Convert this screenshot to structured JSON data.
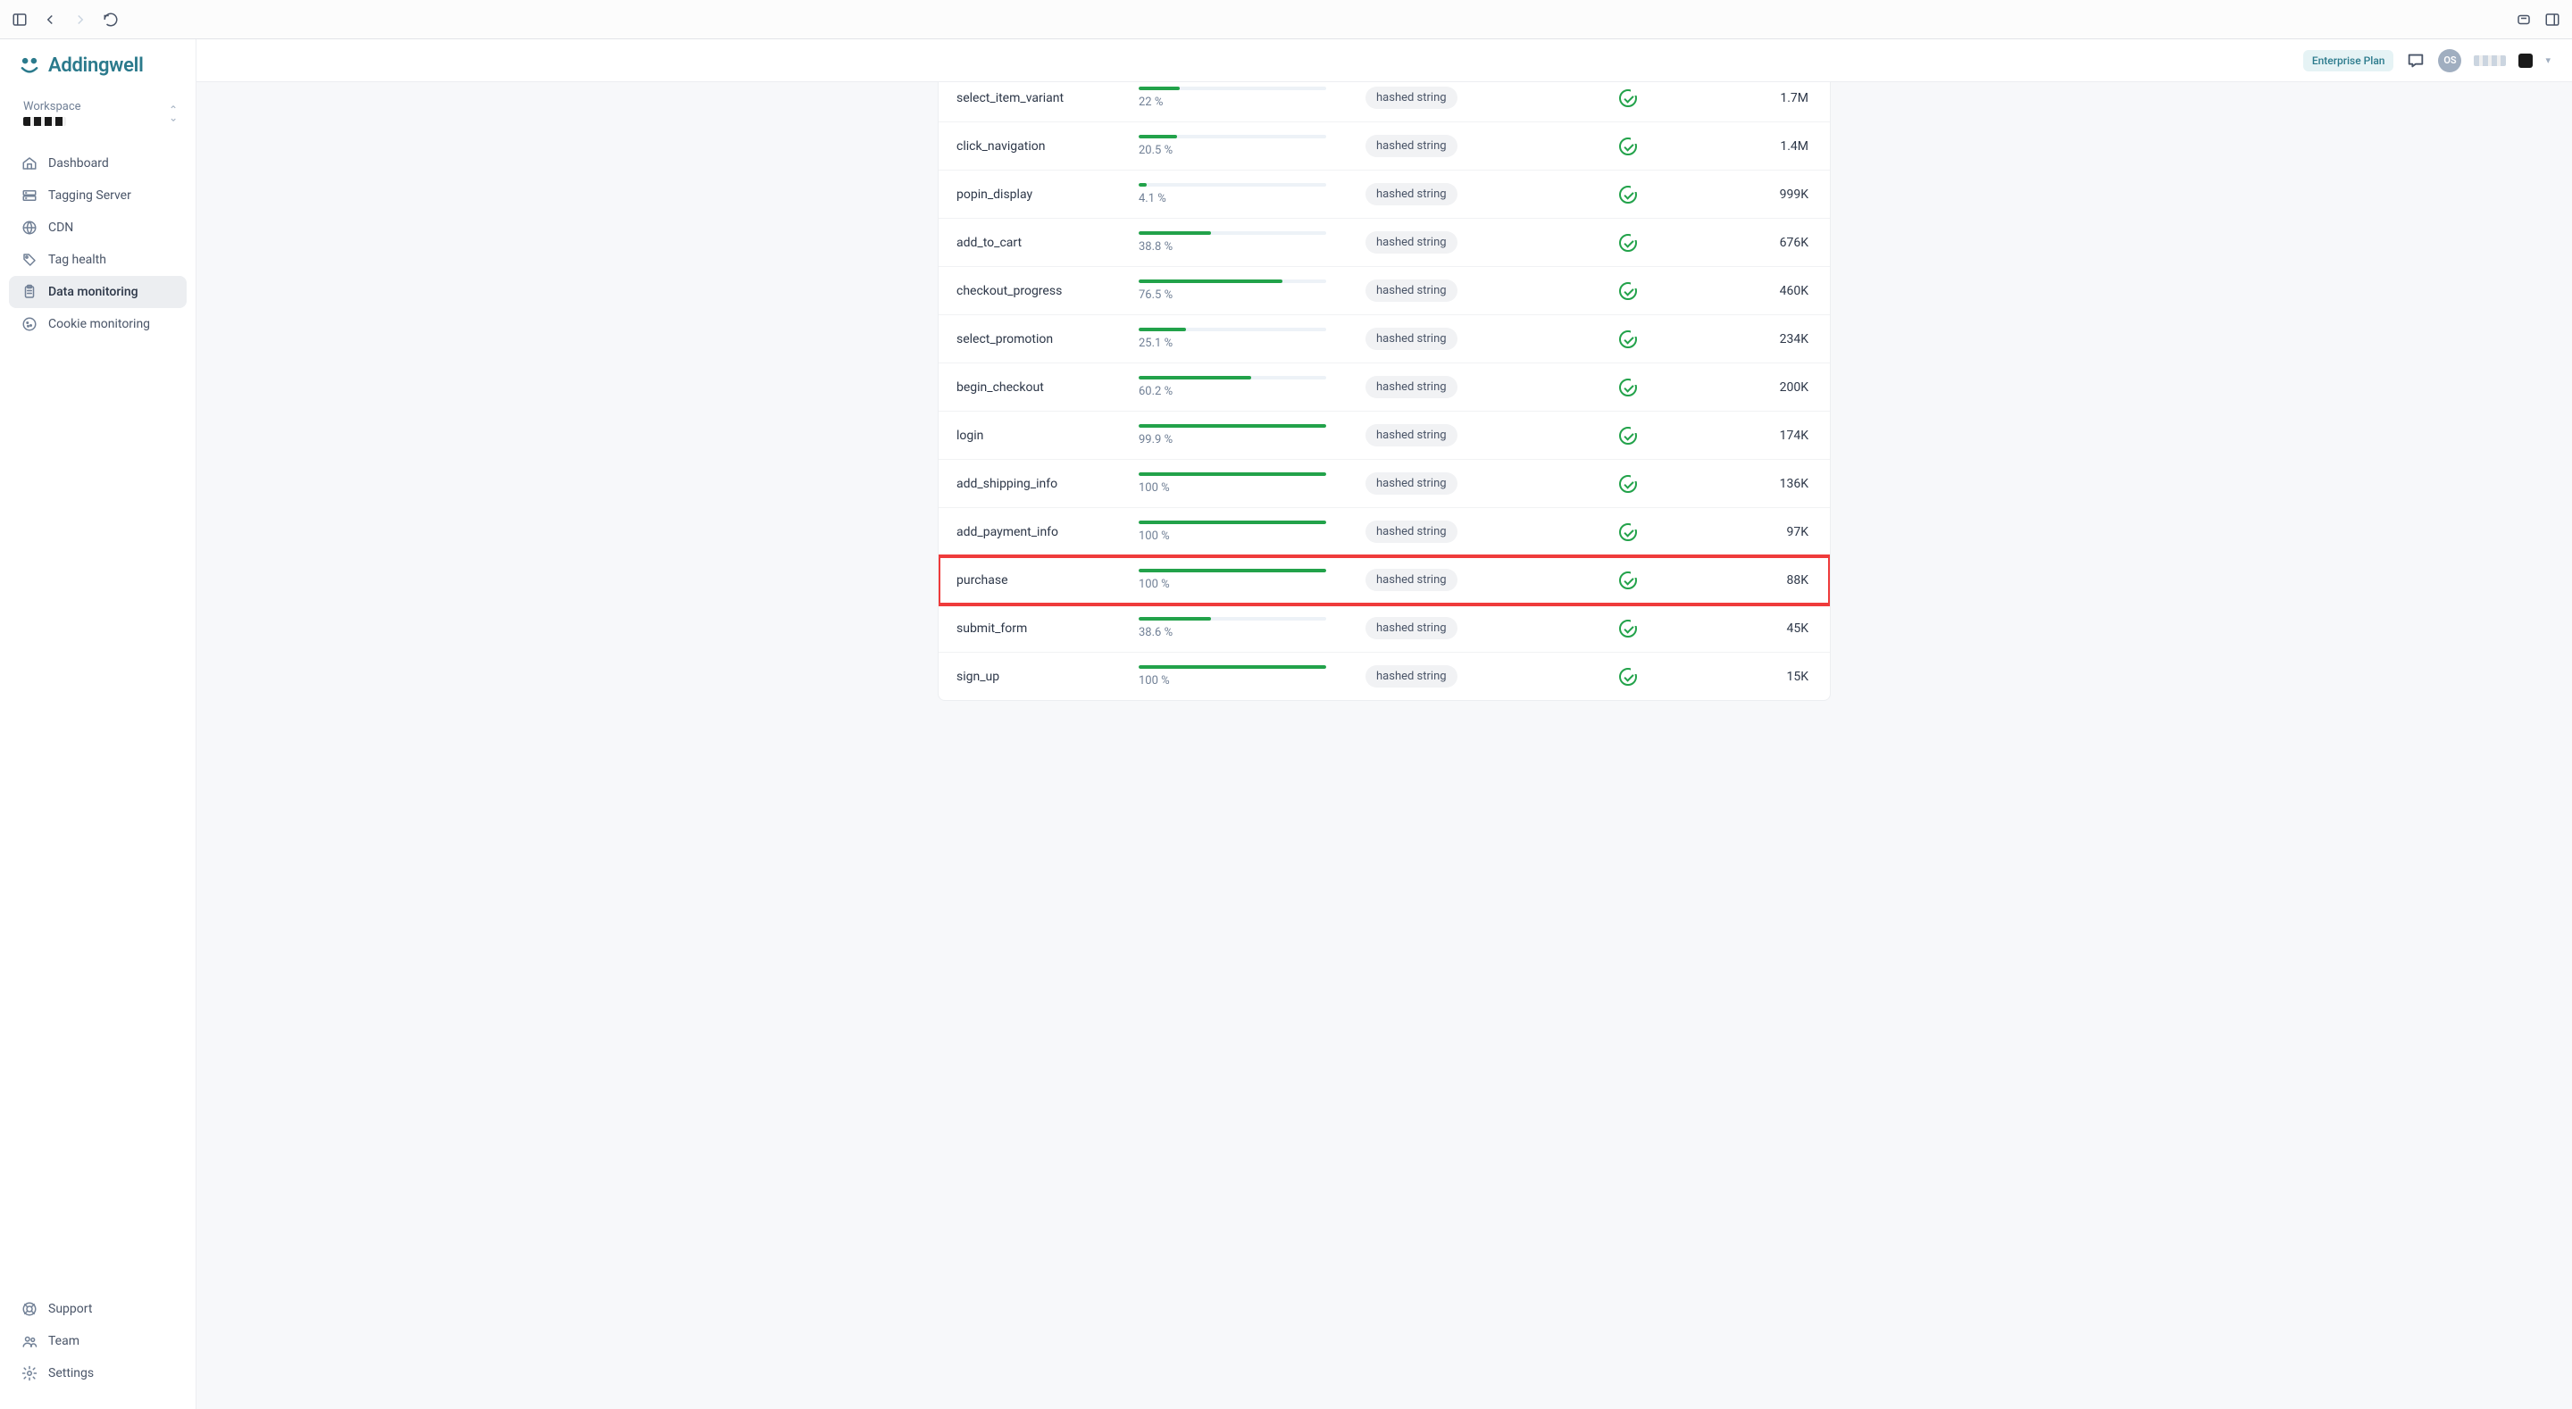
{
  "brand": {
    "name": "Addingwell"
  },
  "workspace": {
    "label": "Workspace"
  },
  "sidebar": {
    "items": [
      {
        "label": "Dashboard",
        "icon": "home-icon"
      },
      {
        "label": "Tagging Server",
        "icon": "server-icon"
      },
      {
        "label": "CDN",
        "icon": "globe-icon"
      },
      {
        "label": "Tag health",
        "icon": "tag-icon"
      },
      {
        "label": "Data monitoring",
        "icon": "clipboard-icon",
        "active": true
      },
      {
        "label": "Cookie monitoring",
        "icon": "cookie-icon"
      }
    ],
    "footer": [
      {
        "label": "Support",
        "icon": "lifebuoy-icon"
      },
      {
        "label": "Team",
        "icon": "users-icon"
      },
      {
        "label": "Settings",
        "icon": "gear-icon"
      }
    ]
  },
  "topbar": {
    "plan": "Enterprise Plan",
    "avatar_initials": "OS"
  },
  "hashed_string_label": "hashed string",
  "rows": [
    {
      "name": "select_item_variant",
      "pct": 22.0,
      "pct_label": "22 %",
      "count": "1.7M"
    },
    {
      "name": "click_navigation",
      "pct": 20.5,
      "pct_label": "20.5 %",
      "count": "1.4M"
    },
    {
      "name": "popin_display",
      "pct": 4.1,
      "pct_label": "4.1 %",
      "count": "999K"
    },
    {
      "name": "add_to_cart",
      "pct": 38.8,
      "pct_label": "38.8 %",
      "count": "676K"
    },
    {
      "name": "checkout_progress",
      "pct": 76.5,
      "pct_label": "76.5 %",
      "count": "460K"
    },
    {
      "name": "select_promotion",
      "pct": 25.1,
      "pct_label": "25.1 %",
      "count": "234K"
    },
    {
      "name": "begin_checkout",
      "pct": 60.2,
      "pct_label": "60.2 %",
      "count": "200K"
    },
    {
      "name": "login",
      "pct": 99.9,
      "pct_label": "99.9 %",
      "count": "174K"
    },
    {
      "name": "add_shipping_info",
      "pct": 100.0,
      "pct_label": "100 %",
      "count": "136K"
    },
    {
      "name": "add_payment_info",
      "pct": 100.0,
      "pct_label": "100 %",
      "count": "97K"
    },
    {
      "name": "purchase",
      "pct": 100.0,
      "pct_label": "100 %",
      "count": "88K",
      "highlight": true
    },
    {
      "name": "submit_form",
      "pct": 38.6,
      "pct_label": "38.6 %",
      "count": "45K"
    },
    {
      "name": "sign_up",
      "pct": 100.0,
      "pct_label": "100 %",
      "count": "15K"
    }
  ]
}
